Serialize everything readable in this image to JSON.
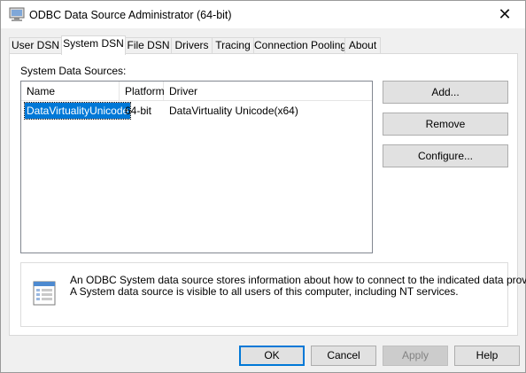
{
  "window": {
    "title": "ODBC Data Source Administrator (64-bit)",
    "close_glyph": "✕",
    "app_icon": "odbc-admin-icon"
  },
  "tabs": [
    {
      "label": "User DSN",
      "active": false
    },
    {
      "label": "System DSN",
      "active": true
    },
    {
      "label": "File DSN",
      "active": false
    },
    {
      "label": "Drivers",
      "active": false
    },
    {
      "label": "Tracing",
      "active": false
    },
    {
      "label": "Connection Pooling",
      "active": false
    },
    {
      "label": "About",
      "active": false
    }
  ],
  "system_dsn": {
    "section_label": "System Data Sources:",
    "columns": [
      "Name",
      "Platform",
      "Driver"
    ],
    "rows": [
      {
        "name": "DataVirtualityUnicode",
        "platform": "64-bit",
        "driver": "DataVirtuality Unicode(x64)",
        "selected": true
      }
    ],
    "buttons": {
      "add": "Add...",
      "remove": "Remove",
      "configure": "Configure..."
    },
    "info_icon": "data-source-info-icon",
    "info_line1": "An ODBC System data source stores information about how to connect to the indicated data provider.",
    "info_line2": "A System data source is visible to all users of this computer, including NT services."
  },
  "footer": {
    "ok": "OK",
    "cancel": "Cancel",
    "apply": "Apply",
    "help": "Help"
  },
  "colors": {
    "selection": "#0078d7",
    "button_face": "#e1e1e1",
    "window_bg": "#f0f0f0"
  }
}
